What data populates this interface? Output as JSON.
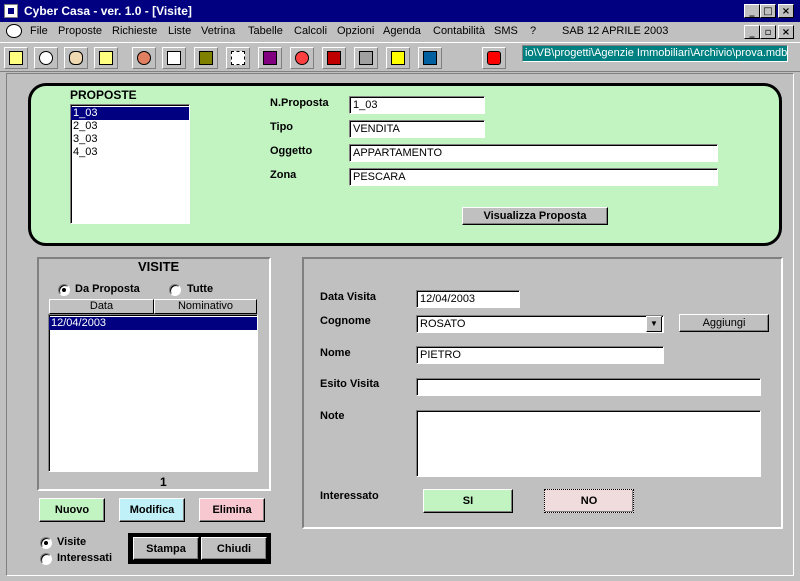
{
  "window": {
    "title": "Cyber Casa - ver. 1.0 - [Visite]",
    "minimize": "_",
    "maximize": "□",
    "close": "×",
    "child_minimize": "_",
    "child_restore": "▫",
    "child_close": "×"
  },
  "menu": {
    "items": [
      "File",
      "Proposte",
      "Richieste",
      "Liste",
      "Vetrina",
      "Tabelle",
      "Calcoli",
      "Opzioni",
      "Agenda",
      "Contabilità",
      "SMS",
      "?"
    ],
    "date": "SAB 12 APRILE 2003"
  },
  "toolbar": {
    "path": "io\\VB\\progetti\\Agenzie Immobiliari\\Archivio\\prova.mdb",
    "icons": [
      "notepad-icon",
      "eye-icon",
      "ear-icon",
      "card-icon",
      "person-icon",
      "document-icon",
      "monitor-icon",
      "grid-icon",
      "chart-icon",
      "pie-icon",
      "book-icon",
      "calculator-icon",
      "note-icon",
      "building-icon",
      "lock-icon"
    ]
  },
  "proposte": {
    "title": "PROPOSTE",
    "items": [
      "1_03",
      "2_03",
      "3_03",
      "4_03"
    ],
    "labels": {
      "n_proposta": "N.Proposta",
      "tipo": "Tipo",
      "oggetto": "Oggetto",
      "zona": "Zona"
    },
    "values": {
      "n_proposta": "1_03",
      "tipo": "VENDITA",
      "oggetto": "APPARTAMENTO",
      "zona": "PESCARA"
    },
    "view_button": "Visualizza Proposta"
  },
  "visite": {
    "title": "VISITE",
    "radio_da_proposta": "Da Proposta",
    "radio_tutte": "Tutte",
    "col_data": "Data",
    "col_nominativo": "Nominativo",
    "rows": [
      "12/04/2003"
    ],
    "count": "1",
    "btn_nuovo": "Nuovo",
    "btn_modifica": "Modifica",
    "btn_elimina": "Elimina",
    "radio_visite": "Visite",
    "radio_interessati": "Interessati",
    "btn_stampa": "Stampa",
    "btn_chiudi": "Chiudi"
  },
  "detail": {
    "labels": {
      "data_visita": "Data Visita",
      "cognome": "Cognome",
      "nome": "Nome",
      "esito": "Esito Visita",
      "note": "Note",
      "interessato": "Interessato"
    },
    "values": {
      "data_visita": "12/04/2003",
      "cognome": "ROSATO",
      "nome": "PIETRO",
      "esito": "",
      "note": ""
    },
    "btn_aggiungi": "Aggiungi",
    "btn_si": "SI",
    "btn_no": "NO"
  },
  "colors": {
    "green_panel": "#c2f4c2",
    "nuovo": "#c2f4c2",
    "modifica": "#c0f0f8",
    "elimina": "#f8c8d0",
    "si": "#c2f4c2",
    "no": "#f0dcdc",
    "selection": "#000080"
  }
}
